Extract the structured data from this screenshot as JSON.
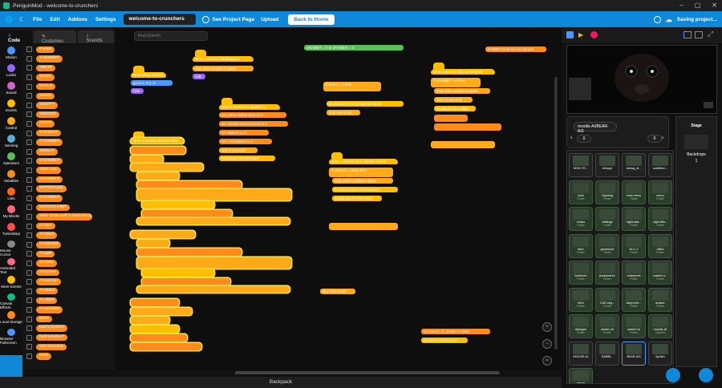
{
  "window": {
    "title": "PenguinMod - welcome-to-crunchers"
  },
  "menubar": {
    "file": "File",
    "edit": "Edit",
    "addons": "Addons",
    "settings": "Settings",
    "project_name": "welcome-to-crunchers",
    "see_project_page": "See Project Page",
    "upload": "Upload",
    "back_home": "Back to Home",
    "saving": "Saving project..."
  },
  "tabs": {
    "code": "Code",
    "costumes": "Costumes",
    "sounds": "Sounds"
  },
  "find_placeholder": "Find (Ctrl+F)",
  "categories": [
    {
      "label": "Motion",
      "color": "#4c97ff"
    },
    {
      "label": "Looks",
      "color": "#9966ff"
    },
    {
      "label": "Sound",
      "color": "#cf63cf"
    },
    {
      "label": "Events",
      "color": "#ffbf00"
    },
    {
      "label": "Control",
      "color": "#ffab19"
    },
    {
      "label": "Sensing",
      "color": "#5cb1d6"
    },
    {
      "label": "Operators",
      "color": "#59c059"
    },
    {
      "label": "Variables",
      "color": "#ff8c1a"
    },
    {
      "label": "Lists",
      "color": "#ff661a"
    },
    {
      "label": "My Blocks",
      "color": "#ff6680"
    },
    {
      "label": "TurboWarp",
      "color": "#ff4c4c"
    },
    {
      "label": "Mouse Cursor",
      "color": "#888888"
    },
    {
      "label": "Animated Text",
      "color": "#ff6680"
    },
    {
      "label": "More Events",
      "color": "#ffbf00"
    },
    {
      "label": "Canvas Effects",
      "color": "#0fbd8c"
    },
    {
      "label": "Local Storage",
      "color": "#ff8c1a"
    },
    {
      "label": "Browser Fullscreen",
      "color": "#4c97ff"
    }
  ],
  "palette_vars": [
    "# week",
    "1-NUMBER",
    "1BEAR",
    "1bear1",
    "1GOLD",
    "1level1",
    "1MARTY",
    "1MOOSE",
    "1TOTE",
    "1TRABBIT",
    "2-NUMBER",
    "2MOLLY",
    "3-NUMBER",
    "3ORLAND",
    "4-NUMBER",
    "4SPRINKLES",
    "5-NUMBER",
    "5CROSCHNER",
    "allow do do stuff in bedroom (paused)",
    "AI-bear",
    "AI-clown",
    "AI-cluncfell",
    "AI-gold",
    "AI-marty",
    "AI-moose",
    "AI-moccan",
    "AI-orland",
    "AI-rabbit",
    "AI-sprinkles",
    "alarm",
    "bad-hydrotics?",
    "bedroomdoor?",
    "cam-selection",
    "cams"
  ],
  "scripts": {
    "s1_hat": "when [flag] clicked",
    "s1_go": "go to x: 0 y: 0",
    "s1_hide": "hide",
    "s2_hat": "when I receive hidethegame",
    "s2_stop": "stop other scripts in sprite",
    "s2_hide": "hide",
    "s3_hat": "when I receive AI-spawns-1",
    "s3_b1": "set came-visible-DLC to 0",
    "s3_b2": "set disable-electrocheck to 0",
    "s3_b3": "set 1BEAR to 0",
    "s3_b4": "set 1-NUMBER to 0",
    "s3_b5": "wait 5 seconds",
    "s3_b6": "broadcast SPAWN bear",
    "big_hat": "when I receive SPAWN bear",
    "top_b1": "1RABBIT = 2 or 1RABBIT = 4",
    "top_b2": "RABBIT-most recent camera",
    "door_if": "if door? = 1 then",
    "door_b1": "broadcast marty-jumpscare-timer",
    "door_b2": "stop this script",
    "dlc_hat": "when I receive DLC-jumpscare",
    "dlc_if": "if 1RABBIT = 4 then",
    "dlc_b1": "stop other scripts in sprite",
    "dlc_b2": "wait 10 seconds",
    "dlc_b3": "broadcast DLC-atlas",
    "elec_hat": "when I receive DLC-electric shock",
    "elec_if": "if 1BEAR = cam4 then",
    "elec_b1": "stop other scripts in sprite",
    "elec_b2": "broadcast DLC-moosecams",
    "elec_b3": "broadcast DPAWN bear",
    "stop_this": "stop this script",
    "saved_b1": "set saved_of_death? to false",
    "saved_b2": "broadcast jumpscare"
  },
  "stage": {
    "label": "Stage",
    "backdrops_label": "Backdrops",
    "backdrops_count": "1"
  },
  "sprite_info": {
    "name": "mostlis-AI/BEAR-AI3",
    "x_label": "x",
    "x": "0",
    "y_label": "y",
    "y": "0"
  },
  "sprites": [
    {
      "name": "MOD FO...",
      "type": ""
    },
    {
      "name": "debug1",
      "type": ""
    },
    {
      "name": "debug_di...",
      "type": ""
    },
    {
      "name": "subtitles/...",
      "type": ""
    },
    {
      "name": "misc",
      "type": "Folder"
    },
    {
      "name": "Opening",
      "type": "Folder"
    },
    {
      "name": "mod menu",
      "type": "Folder"
    },
    {
      "name": "menu",
      "type": "Folder"
    },
    {
      "name": "extras",
      "type": "Folder"
    },
    {
      "name": "settings",
      "type": "Folder"
    },
    {
      "name": "night-star...",
      "type": "Folder"
    },
    {
      "name": "night-title...",
      "type": "Folder"
    },
    {
      "name": "8am",
      "type": "Folder"
    },
    {
      "name": "gameover",
      "type": "Folder"
    },
    {
      "name": "DLC-1",
      "type": "Folder"
    },
    {
      "name": "office",
      "type": "Folder"
    },
    {
      "name": "bedroom",
      "type": "Folder"
    },
    {
      "name": "jumpscares",
      "type": "Folder"
    },
    {
      "name": "cutscenes",
      "type": "Folder"
    },
    {
      "name": "custom n...",
      "type": "Folder"
    },
    {
      "name": "intro",
      "type": "Folder"
    },
    {
      "name": "CAR-seg...",
      "type": "Folder"
    },
    {
      "name": "diary-entr...",
      "type": "Folder"
    },
    {
      "name": "drawer",
      "type": "Folder"
    },
    {
      "name": "dialogue",
      "type": "Folder"
    },
    {
      "name": "week1-AI",
      "type": "Folder"
    },
    {
      "name": "week2-AI",
      "type": "Folder"
    },
    {
      "name": "mostlis-AI",
      "type": "Opened"
    },
    {
      "name": "MOOSE-AI",
      "type": ""
    },
    {
      "name": "RABBI...",
      "type": ""
    },
    {
      "name": "BEAR-AI3",
      "type": ""
    },
    {
      "name": "Sprite1",
      "type": ""
    },
    {
      "name": "pause",
      "type": "Folder"
    }
  ],
  "backpack": "Backpack"
}
